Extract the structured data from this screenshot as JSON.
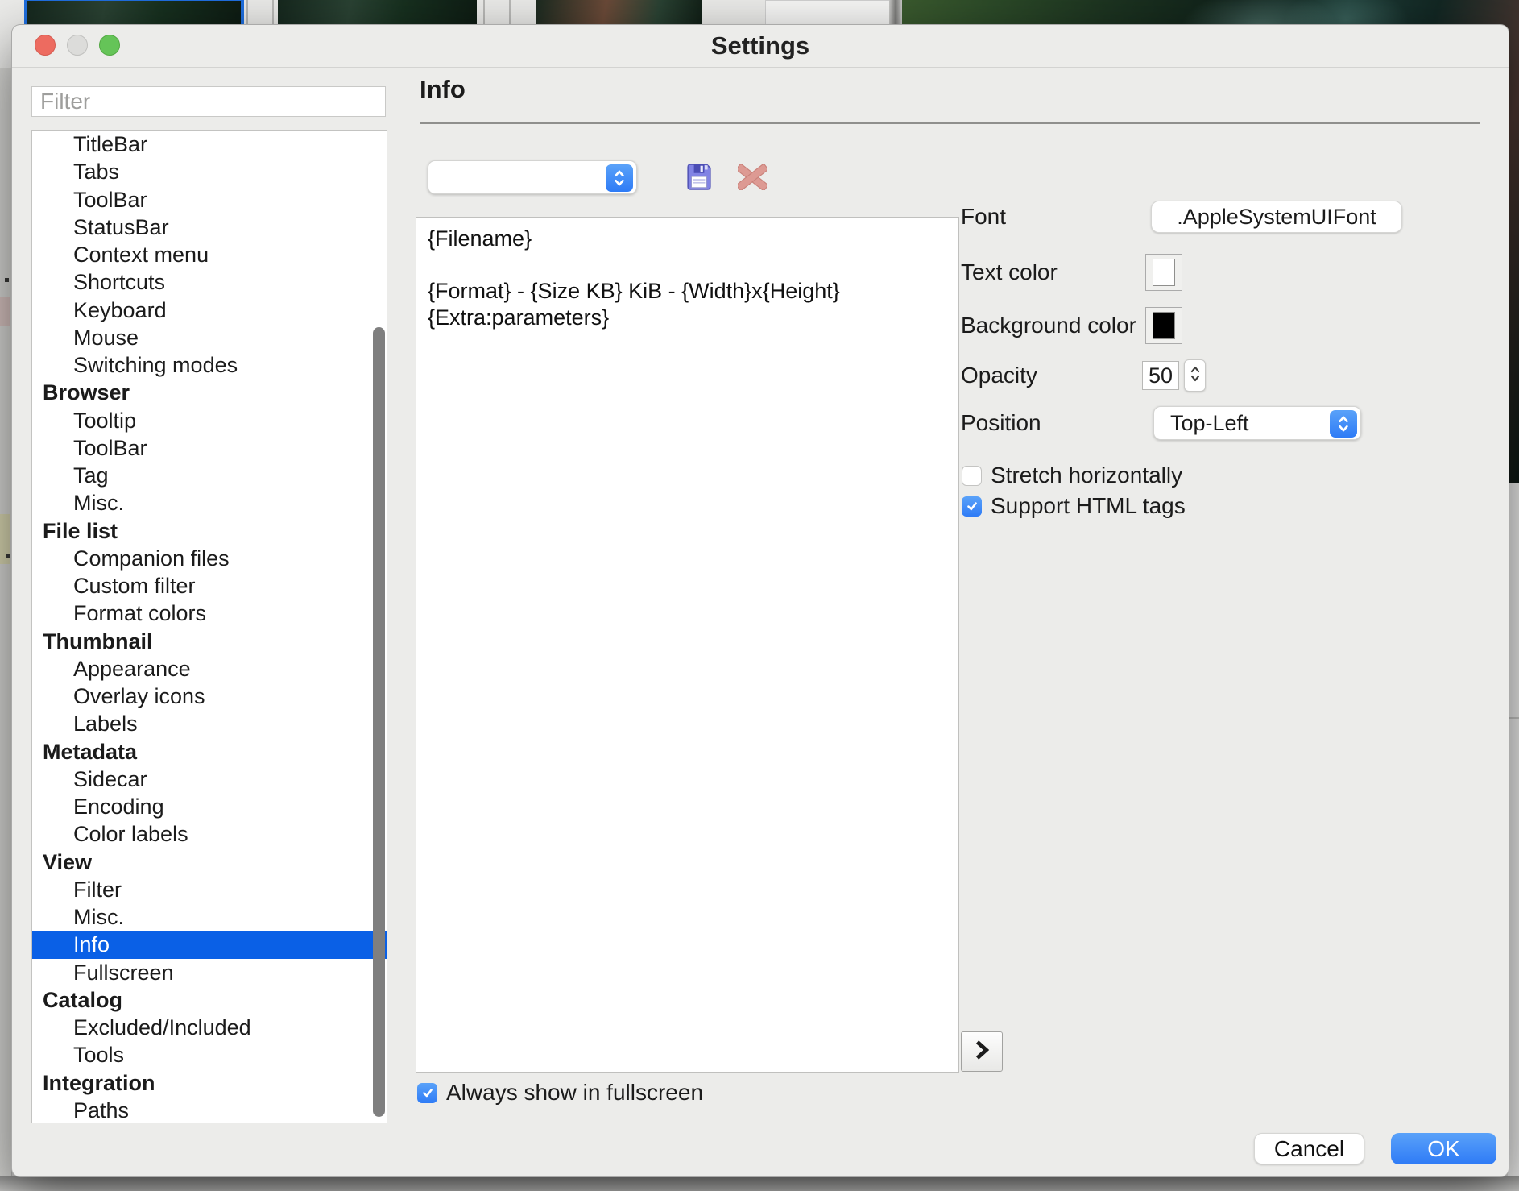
{
  "window": {
    "title": "Settings",
    "traffic_lights": [
      "close",
      "minimize-disabled",
      "zoom"
    ]
  },
  "sidebar": {
    "filter_placeholder": "Filter",
    "items": [
      {
        "label": "TitleBar",
        "type": "item"
      },
      {
        "label": "Tabs",
        "type": "item"
      },
      {
        "label": "ToolBar",
        "type": "item"
      },
      {
        "label": "StatusBar",
        "type": "item"
      },
      {
        "label": "Context menu",
        "type": "item"
      },
      {
        "label": "Shortcuts",
        "type": "item"
      },
      {
        "label": "Keyboard",
        "type": "item"
      },
      {
        "label": "Mouse",
        "type": "item"
      },
      {
        "label": "Switching modes",
        "type": "item"
      },
      {
        "label": "Browser",
        "type": "header"
      },
      {
        "label": "Tooltip",
        "type": "item"
      },
      {
        "label": "ToolBar",
        "type": "item"
      },
      {
        "label": "Tag",
        "type": "item"
      },
      {
        "label": "Misc.",
        "type": "item"
      },
      {
        "label": "File list",
        "type": "header"
      },
      {
        "label": "Companion files",
        "type": "item"
      },
      {
        "label": "Custom filter",
        "type": "item"
      },
      {
        "label": "Format colors",
        "type": "item"
      },
      {
        "label": "Thumbnail",
        "type": "header"
      },
      {
        "label": "Appearance",
        "type": "item"
      },
      {
        "label": "Overlay icons",
        "type": "item"
      },
      {
        "label": "Labels",
        "type": "item"
      },
      {
        "label": "Metadata",
        "type": "header"
      },
      {
        "label": "Sidecar",
        "type": "item"
      },
      {
        "label": "Encoding",
        "type": "item"
      },
      {
        "label": "Color labels",
        "type": "item"
      },
      {
        "label": "View",
        "type": "header"
      },
      {
        "label": "Filter",
        "type": "item"
      },
      {
        "label": "Misc.",
        "type": "item"
      },
      {
        "label": "Info",
        "type": "item",
        "selected": true
      },
      {
        "label": "Fullscreen",
        "type": "item"
      },
      {
        "label": "Catalog",
        "type": "header"
      },
      {
        "label": "Excluded/Included",
        "type": "item"
      },
      {
        "label": "Tools",
        "type": "item"
      },
      {
        "label": "Integration",
        "type": "header"
      },
      {
        "label": "Paths",
        "type": "item"
      }
    ]
  },
  "content": {
    "heading": "Info",
    "preset": {
      "dropdown_value": ""
    },
    "template_lines": [
      "{Filename}",
      "",
      "{Format} - {Size KB} KiB - {Width}x{Height}",
      "{Extra:parameters}"
    ],
    "fields": {
      "font": {
        "label": "Font",
        "value": ".AppleSystemUIFont"
      },
      "text_color": {
        "label": "Text color",
        "value": "#FFFFFF"
      },
      "background_color": {
        "label": "Background color",
        "value": "#000000"
      },
      "opacity": {
        "label": "Opacity",
        "value": "50"
      },
      "position": {
        "label": "Position",
        "value": "Top-Left"
      }
    },
    "checkboxes": {
      "stretch": {
        "label": "Stretch horizontally",
        "checked": false
      },
      "html": {
        "label": "Support HTML tags",
        "checked": true
      },
      "fullscreen": {
        "label": "Always show in fullscreen",
        "checked": true
      }
    }
  },
  "footer": {
    "cancel_label": "Cancel",
    "ok_label": "OK"
  },
  "icons": {
    "save": "floppy-disk-icon",
    "delete": "red-x-icon",
    "preset_stepper": "up-down-chevrons-icon",
    "opacity_stepper": "up-down-chevrons-icon",
    "next": "chevron-right-icon"
  },
  "colors": {
    "accent": "#2e7bf6",
    "selection": "#0a60e6",
    "delete_icon": "#dd9a93",
    "save_icon": "#8183e4"
  }
}
